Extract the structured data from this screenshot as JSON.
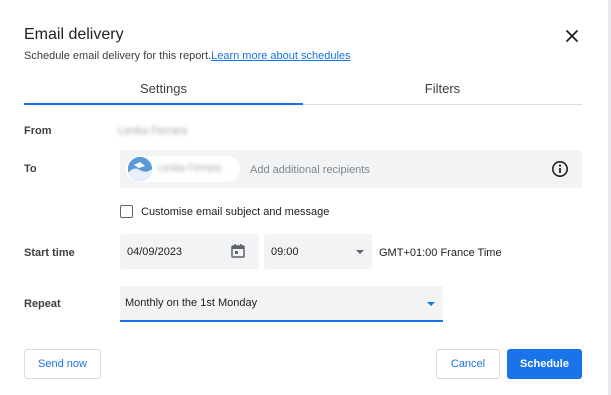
{
  "dialog": {
    "title": "Email delivery",
    "subtitle": "Schedule email delivery for this report.",
    "learn_more": "Learn more about schedules"
  },
  "tabs": [
    {
      "label": "Settings",
      "active": true
    },
    {
      "label": "Filters",
      "active": false
    }
  ],
  "form": {
    "from_label": "From",
    "from_value": "Lenka Ferrara",
    "to_label": "To",
    "recipient_name": "Lenka Ferrara",
    "to_placeholder": "Add additional recipients",
    "customise_label": "Customise email subject and message",
    "customise_checked": false,
    "start_time_label": "Start time",
    "start_date": "04/09/2023",
    "start_time": "09:00",
    "timezone": "GMT+01:00 France Time",
    "repeat_label": "Repeat",
    "repeat_value": "Monthly on the 1st Monday"
  },
  "buttons": {
    "send_now": "Send now",
    "cancel": "Cancel",
    "schedule": "Schedule"
  },
  "icons": {
    "close": "close-icon",
    "info": "info-icon",
    "calendar": "calendar-icon",
    "dropdown": "chevron-down-icon"
  },
  "colors": {
    "accent": "#1a73e8",
    "field_bg": "#f1f3f4",
    "text": "#202124"
  }
}
